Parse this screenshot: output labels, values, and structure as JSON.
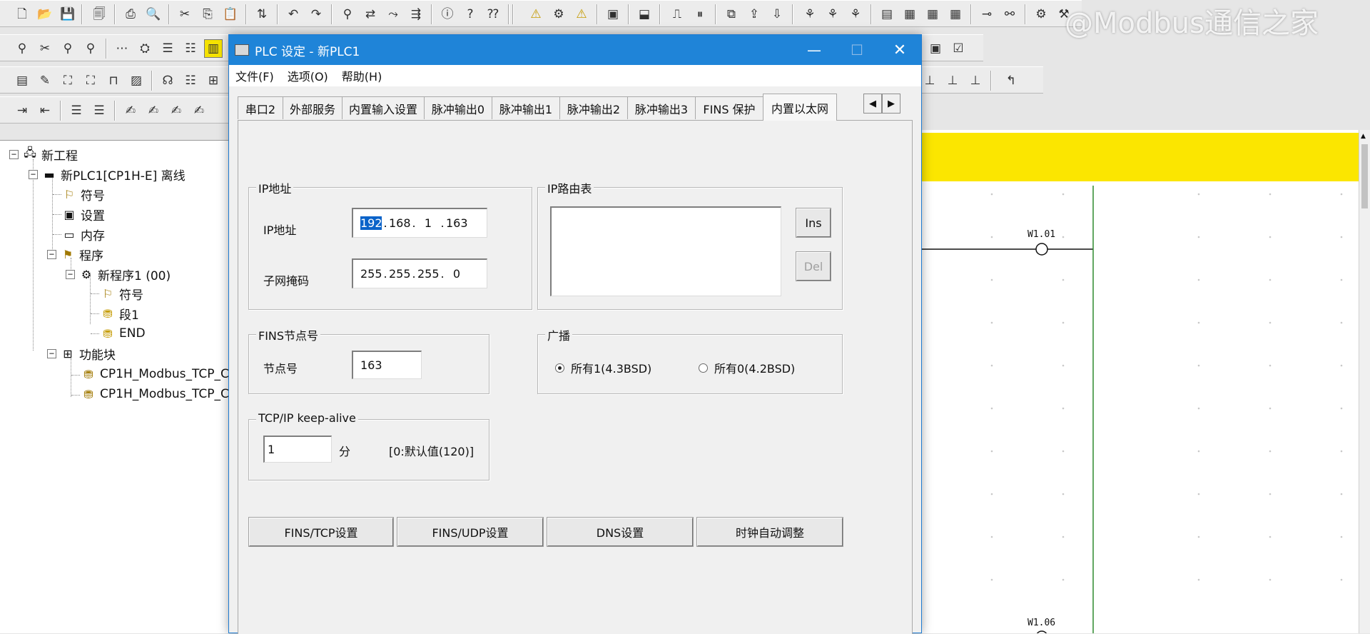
{
  "watermark": "@Modbus通信之家",
  "toolbar": {
    "icons": [
      "new-icon",
      "open-icon",
      "save-icon",
      "properties-icon",
      "print-icon",
      "print-preview-icon",
      "cut-icon",
      "copy-icon",
      "paste-icon",
      "transfer-icon",
      "undo-icon",
      "redo-icon",
      "find-icon",
      "replace-icon",
      "jump-icon",
      "cross-reference-icon",
      "about-icon",
      "help-icon",
      "context-help-icon",
      "online-icon",
      "simulation-icon",
      "monitor-icon",
      "device-icon",
      "transfer-to-plc-icon",
      "run-icon",
      "pause-icon",
      "compare-icon",
      "upload-icon",
      "download-icon",
      "step-icon",
      "force-on-icon",
      "force-off-icon",
      "table-icon",
      "grid-icon",
      "watch-icon",
      "address-icon",
      "memory-icon",
      "network-icon",
      "io-table-icon",
      "settings-icon"
    ]
  },
  "tree": {
    "project": "新工程",
    "plc": "新PLC1[CP1H-E] 离线",
    "symbols": "符号",
    "settings": "设置",
    "memory": "内存",
    "programs": "程序",
    "program1": "新程序1 (00)",
    "program1_symbols": "符号",
    "section1": "段1",
    "end": "END",
    "function_blocks": "功能块",
    "fb1": "CP1H_Modbus_TCP_C",
    "fb2": "CP1H_Modbus_TCP_C"
  },
  "ladder": {
    "labels": [
      "W1.01",
      "W1.06"
    ]
  },
  "dialog": {
    "title": "PLC 设定 - 新PLC1",
    "menu": [
      "文件(F)",
      "选项(O)",
      "帮助(H)"
    ],
    "tabs": [
      "串口2",
      "外部服务",
      "内置输入设置",
      "脉冲输出0",
      "脉冲输出1",
      "脉冲输出2",
      "脉冲输出3",
      "FINS 保护",
      "内置以太网"
    ],
    "active_tab": "内置以太网",
    "ip_group": {
      "title": "IP地址",
      "ip_label": "IP地址",
      "ip": [
        "192",
        "168",
        "1",
        "163"
      ],
      "mask_label": "子网掩码",
      "mask": [
        "255",
        "255",
        "255",
        "0"
      ]
    },
    "route_group": {
      "title": "IP路由表",
      "ins": "Ins",
      "del": "Del"
    },
    "fins_group": {
      "title": "FINS节点号",
      "node_label": "节点号",
      "node_value": "163"
    },
    "broadcast_group": {
      "title": "广播",
      "opt1": "所有1(4.3BSD)",
      "opt2": "所有0(4.2BSD)",
      "selected": "所有1(4.3BSD)"
    },
    "keepalive_group": {
      "title": "TCP/IP keep-alive",
      "value": "1",
      "unit": "分",
      "hint": "[0:默认值(120)]"
    },
    "buttons": [
      "FINS/TCP设置",
      "FINS/UDP设置",
      "DNS设置",
      "时钟自动调整"
    ]
  }
}
